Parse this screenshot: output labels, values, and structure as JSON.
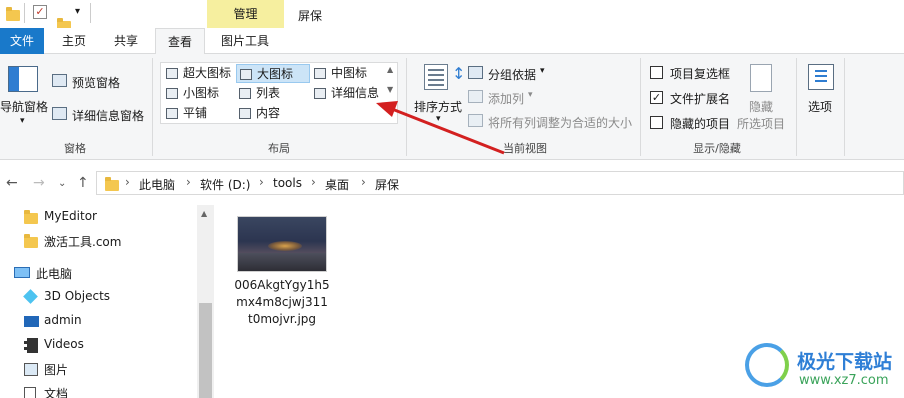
{
  "titlebar": {
    "quick_access_dropdown": "▾",
    "context_tab": "管理",
    "window_title": "屏保",
    "colors": {
      "context_tab_bg": "#f6ef9f"
    }
  },
  "tabs": [
    "文件",
    "主页",
    "共享",
    "查看",
    "图片工具"
  ],
  "ribbon": {
    "panes": {
      "nav_pane": "导航窗格",
      "preview_pane": "预览窗格",
      "details_pane": "详细信息窗格",
      "label": "窗格"
    },
    "layout": {
      "items": [
        "超大图标",
        "大图标",
        "中图标",
        "小图标",
        "列表",
        "详细信息",
        "平铺",
        "内容"
      ],
      "selected": "大图标",
      "label": "布局"
    },
    "current_view": {
      "sort_by": "排序方式",
      "group_by": "分组依据",
      "add_column": "添加列",
      "size_all_columns": "将所有列调整为合适的大小",
      "label": "当前视图"
    },
    "show_hide": {
      "item_checkboxes": "项目复选框",
      "file_extensions": "文件扩展名",
      "hidden_items": "隐藏的项目",
      "hide_selected_line1": "隐藏",
      "hide_selected_line2": "所选项目",
      "label": "显示/隐藏",
      "checked": [
        "文件扩展名"
      ]
    },
    "options": "选项"
  },
  "address": {
    "breadcrumbs": [
      "此电脑",
      "软件 (D:)",
      "tools",
      "桌面",
      "屏保"
    ]
  },
  "sidebar": {
    "items": [
      "MyEditor",
      "激活工具.com",
      "此电脑",
      "3D Objects",
      "admin",
      "Videos",
      "图片",
      "文档"
    ]
  },
  "files": [
    {
      "name": "006AkgtYgy1h5mx4m8cjwj311t0mojvr.jpg"
    }
  ],
  "watermark": {
    "title": "极光下载站",
    "url": "www.xz7.com"
  }
}
